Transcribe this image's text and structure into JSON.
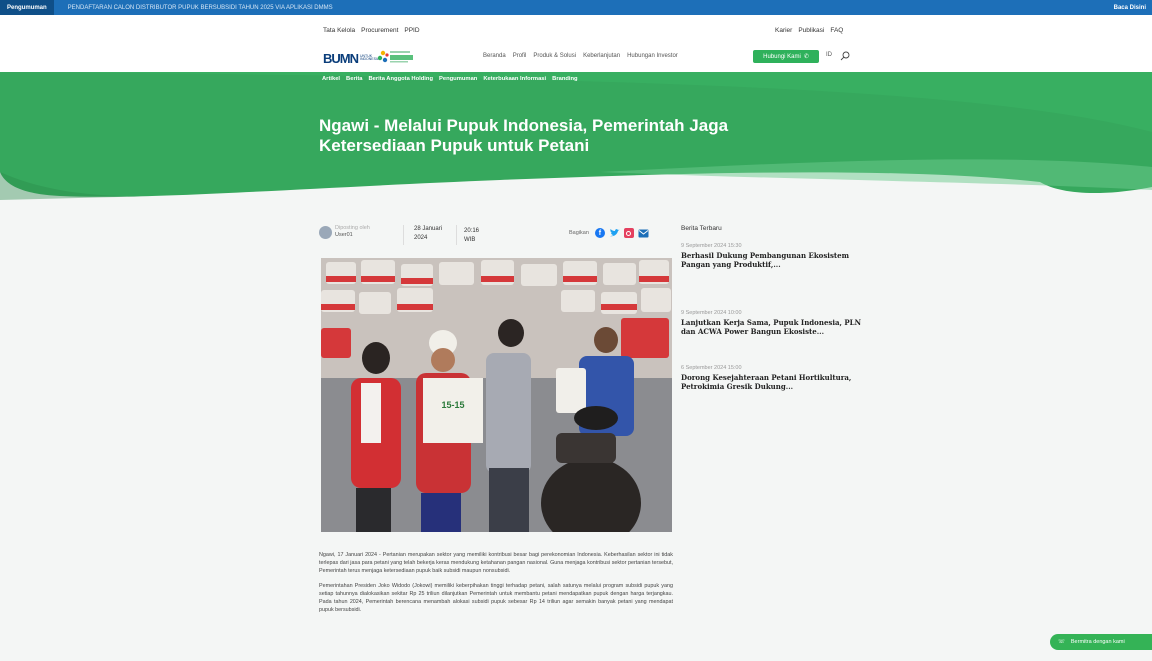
{
  "ticker": {
    "label": "Pengumuman",
    "text": "PENDAFTARAN CALON DISTRIBUTOR PUPUK BERSUBSIDI TAHUN 2025 VIA APLIKASI DMMS",
    "more": "Baca Disini"
  },
  "utility_nav": [
    "Tata Kelola",
    "Procurement",
    "PPID"
  ],
  "utility_nav_right": [
    "Karier",
    "Publikasi",
    "FAQ"
  ],
  "logos": {
    "bumn": "BUMN",
    "bumn_sub": "UNTUK INDONESIA",
    "pupuk": "PUPUK INDONESIA"
  },
  "main_nav": [
    "Beranda",
    "Profil",
    "Produk & Solusi",
    "Keberlanjutan",
    "Hubungan Investor"
  ],
  "contact_button": "Hubungi Kami",
  "lang": "ID",
  "sub_nav": [
    "Artikel",
    "Berita",
    "Berita Anggota Holding",
    "Pengumuman",
    "Keterbukaan Informasi",
    "Branding"
  ],
  "article": {
    "title": "Ngawi - Melalui Pupuk Indonesia, Pemerintah Jaga Ketersediaan Pupuk untuk Petani",
    "posted_by": "Diposting oleh",
    "author": "User01",
    "date": "28 Januari 2024",
    "time": "20:16 WIB",
    "share_label": "Bagikan",
    "paragraphs": [
      "Ngawi, 17 Januari 2024 - Pertanian merupakan sektor yang memiliki kontribusi besar bagi perekonomian Indonesia. Keberhasilan sektor ini tidak terlepas dari jasa para petani yang telah bekerja keras mendukung ketahanan pangan nasional. Guna menjaga kontribusi sektor pertanian tersebut, Pemerintah terus menjaga ketersediaan pupuk baik subsidi maupun nonsubsidi.",
      "Pemerintahan Presiden Joko Widodo (Jokowi) memiliki keberpihakan tinggi terhadap petani, salah satunya melalui program subsidi pupuk yang setiap tahunnya dialokasikan sekitar Rp 25 triliun dilanjutkan Pemerintah untuk membantu petani mendapatkan pupuk dengan harga terjangkau. Pada tahun 2024, Pemerintah berencana menambah alokasi subsidi pupuk sebesar Rp 14 triliun agar semakin banyak petani yang mendapat pupuk bersubsidi."
    ]
  },
  "sidebar": {
    "heading": "Berita Terbaru",
    "items": [
      {
        "date": "9 September 2024 15:30",
        "title": "Berhasil Dukung Pembangunan Ekosistem Pangan yang Produktif,..."
      },
      {
        "date": "9 September 2024 10:00",
        "title": "Lanjutkan Kerja Sama, Pupuk Indonesia, PLN dan ACWA Power Bangun Ekosiste..."
      },
      {
        "date": "6 September 2024 15:00",
        "title": "Dorong Kesejahteraan Petani Hortikultura, Petrokimia Gresik Dukung..."
      }
    ]
  },
  "whatsapp": "Bermitra dengan kami",
  "colors": {
    "green": "#2fb15b",
    "ticker": "#1d6fb8"
  }
}
